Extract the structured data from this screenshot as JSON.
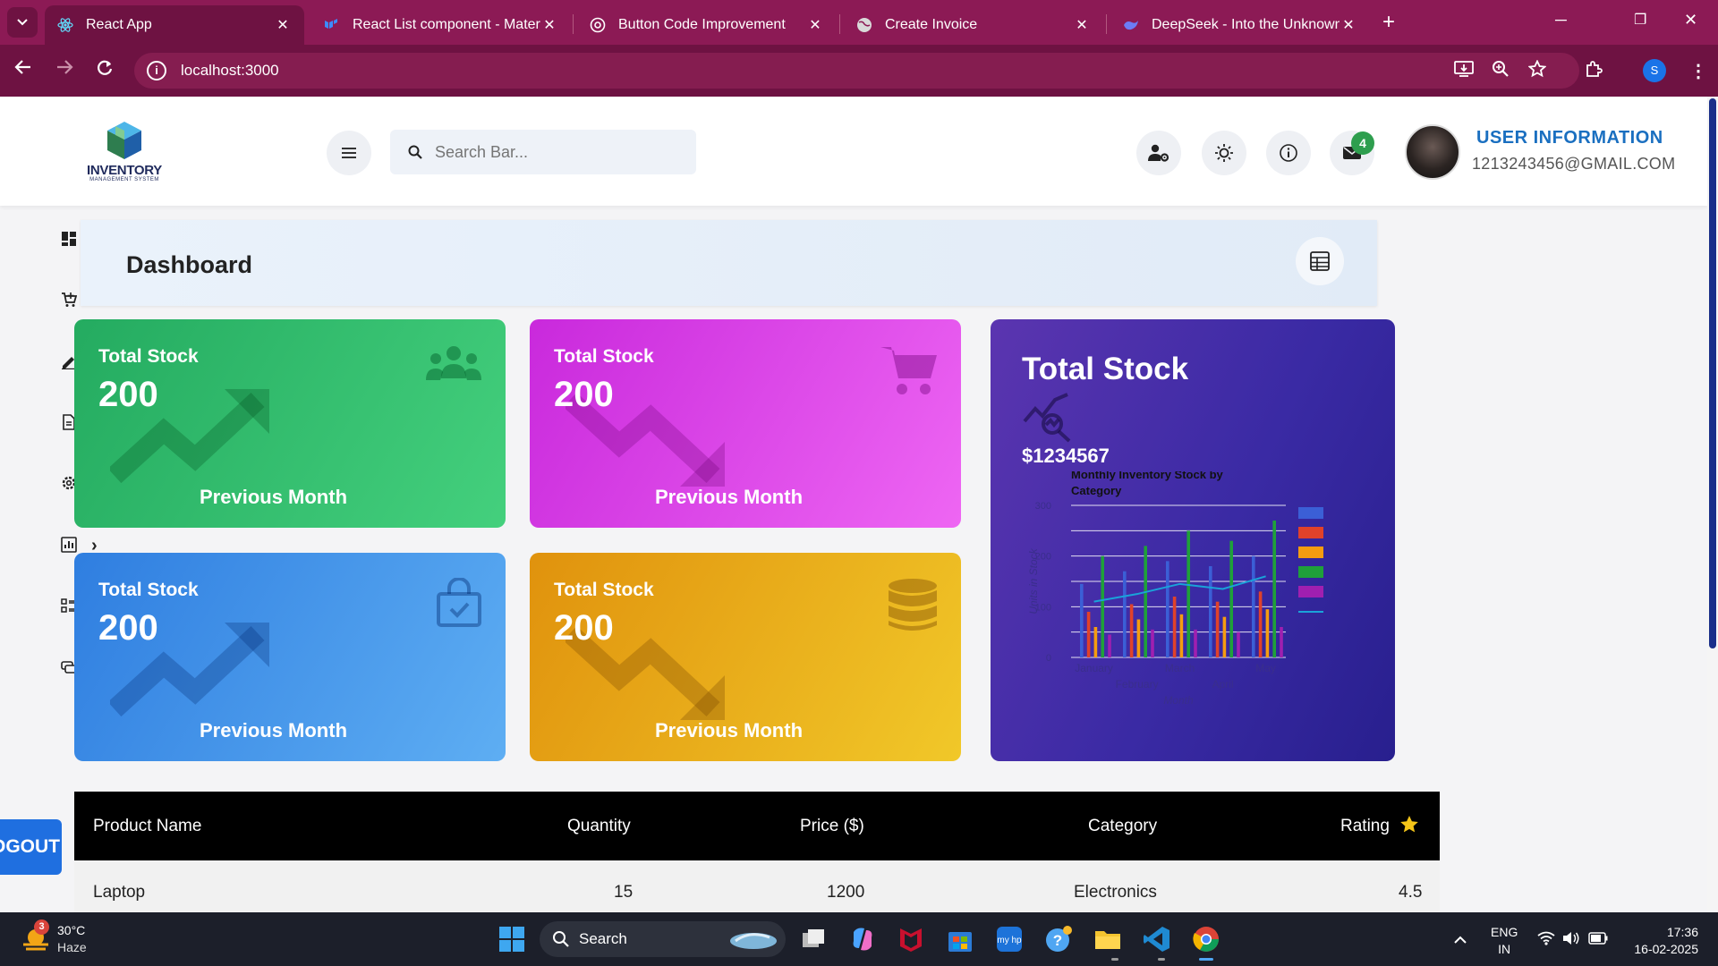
{
  "browser": {
    "tabs": [
      {
        "title": "React App",
        "icon": "react-icon",
        "active": true
      },
      {
        "title": "React List component - Materia",
        "icon": "mui-icon",
        "active": false
      },
      {
        "title": "Button Code Improvement",
        "icon": "openai-icon",
        "active": false
      },
      {
        "title": "Create Invoice",
        "icon": "globe-icon",
        "active": false
      },
      {
        "title": "DeepSeek - Into the Unknown",
        "icon": "deepseek-icon",
        "active": false
      }
    ],
    "url": "localhost:3000",
    "profile_initial": "S",
    "theme_color": "#8c1a55"
  },
  "header": {
    "logo_text": "INVENTORY",
    "logo_subtext": "MANAGEMENT SYSTEM",
    "search_placeholder": "Search Bar...",
    "notification_count": "4",
    "user_title": "USER INFORMATION",
    "user_email": "1213243456@GMAIL.COM"
  },
  "sidebar": {
    "icons": [
      "dashboard-icon",
      "cart-plus-icon",
      "edit-icon",
      "document-icon",
      "settings-icon",
      "report-icon",
      "list-icon",
      "chat-icon"
    ],
    "logout_label": "LOGOUT"
  },
  "dashboard": {
    "title": "Dashboard"
  },
  "cards": [
    {
      "label": "Total Stock",
      "value": "200",
      "footer": "Previous Month",
      "trend": "up",
      "icon": "users-icon",
      "color": "#24ab60"
    },
    {
      "label": "Total Stock",
      "value": "200",
      "footer": "Previous Month",
      "trend": "down",
      "icon": "cart-icon",
      "color": "#c929dc"
    },
    {
      "label": "Total Stock",
      "value": "200",
      "footer": "Previous Month",
      "trend": "up",
      "icon": "shopping-bag-check-icon",
      "color": "#2f7ee0"
    },
    {
      "label": "Total Stock",
      "value": "200",
      "footer": "Previous Month",
      "trend": "down",
      "icon": "database-icon",
      "color": "#e0920d"
    }
  ],
  "summary_card": {
    "title": "Total Stock",
    "value": "$1234567",
    "icon": "chart-search-icon"
  },
  "chart_data": {
    "type": "bar",
    "title": "Monthly Inventory Stock by Category",
    "xlabel": "Month",
    "ylabel": "Units in Stock",
    "categories": [
      "January",
      "February",
      "March",
      "April",
      "May"
    ],
    "ylim": [
      0,
      300
    ],
    "yticks": [
      0,
      100,
      200,
      300
    ],
    "series": [
      {
        "values": [
          145,
          170,
          190,
          180,
          200
        ],
        "color": "#3b5fd6"
      },
      {
        "values": [
          90,
          105,
          120,
          110,
          130
        ],
        "color": "#e0422a"
      },
      {
        "values": [
          60,
          75,
          85,
          80,
          95
        ],
        "color": "#f59c10"
      },
      {
        "values": [
          200,
          220,
          250,
          230,
          270
        ],
        "color": "#1fa03a"
      },
      {
        "values": [
          45,
          55,
          55,
          50,
          60
        ],
        "color": "#a01fb0"
      }
    ],
    "line": {
      "values": [
        110,
        125,
        145,
        135,
        160
      ],
      "color": "#1aa3d9"
    },
    "grid": true,
    "legend": "right"
  },
  "table": {
    "headers": [
      "Product Name",
      "Quantity",
      "Price ($)",
      "Category",
      "Rating"
    ],
    "rows": [
      {
        "name": "Laptop",
        "quantity": "15",
        "price": "1200",
        "category": "Electronics",
        "rating": "4.5"
      }
    ]
  },
  "taskbar": {
    "temperature": "30°C",
    "weather": "Haze",
    "weather_badge": "3",
    "search_label": "Search",
    "lang_line1": "ENG",
    "lang_line2": "IN",
    "time": "17:36",
    "date": "16-02-2025"
  }
}
